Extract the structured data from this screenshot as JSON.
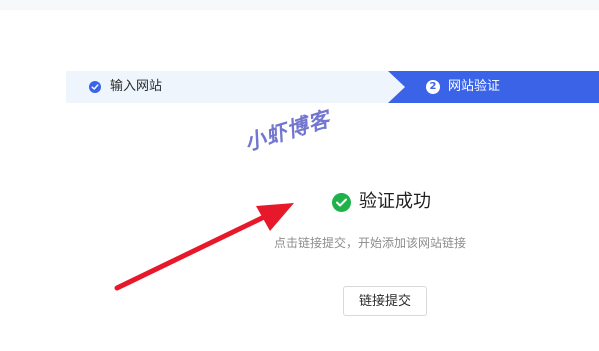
{
  "steps": [
    {
      "label": "输入网站",
      "status": "done"
    },
    {
      "number": "2",
      "label": "网站验证",
      "status": "active"
    }
  ],
  "watermark": "小虾博客",
  "result": {
    "title": "验证成功",
    "description": "点击链接提交，开始添加该网站链接",
    "button_label": "链接提交"
  },
  "colors": {
    "accent": "#3a63e8",
    "success": "#1db24a",
    "annotation_arrow": "#e8182b"
  },
  "icons": {
    "step_done": "check-circle-icon",
    "success": "check-circle-icon"
  }
}
